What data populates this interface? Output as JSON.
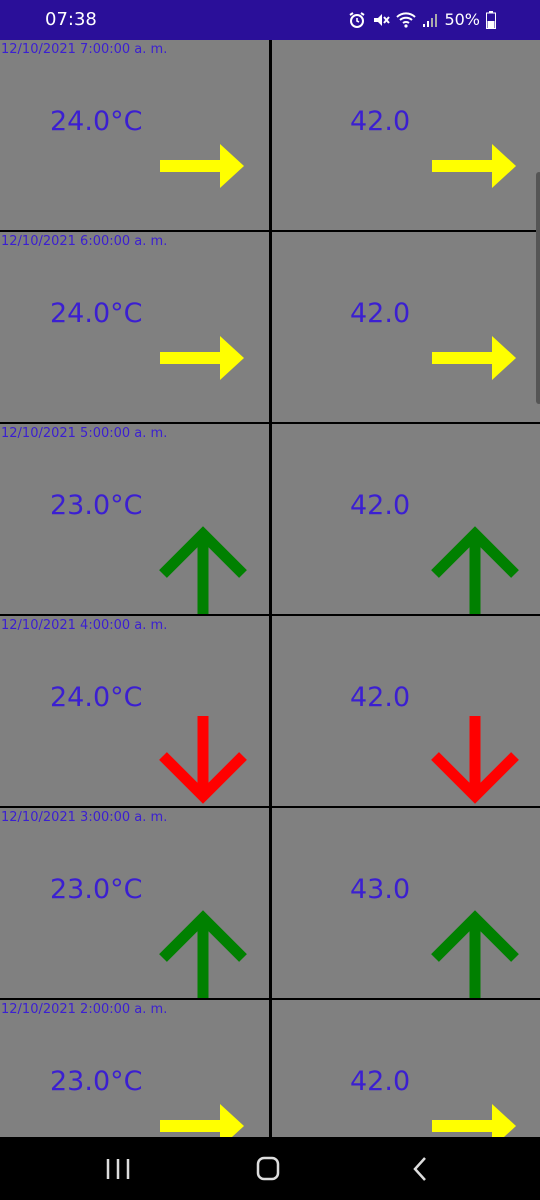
{
  "status_bar": {
    "time": "07:38",
    "battery": "50%"
  },
  "colors": {
    "up": "#008000",
    "down": "#ff0000",
    "flat": "#ffff00",
    "text": "#3b1fd1",
    "cell_bg": "#808080"
  },
  "rows": [
    {
      "timestamp": "12/10/2021 7:00:00 a. m.",
      "temperature": "24.0°C",
      "temp_trend": "flat",
      "humidity": "42.0",
      "hum_trend": "flat"
    },
    {
      "timestamp": "12/10/2021 6:00:00 a. m.",
      "temperature": "24.0°C",
      "temp_trend": "flat",
      "humidity": "42.0",
      "hum_trend": "flat"
    },
    {
      "timestamp": "12/10/2021 5:00:00 a. m.",
      "temperature": "23.0°C",
      "temp_trend": "up",
      "humidity": "42.0",
      "hum_trend": "up"
    },
    {
      "timestamp": "12/10/2021 4:00:00 a. m.",
      "temperature": "24.0°C",
      "temp_trend": "down",
      "humidity": "42.0",
      "hum_trend": "down"
    },
    {
      "timestamp": "12/10/2021 3:00:00 a. m.",
      "temperature": "23.0°C",
      "temp_trend": "up",
      "humidity": "43.0",
      "hum_trend": "up"
    },
    {
      "timestamp": "12/10/2021 2:00:00 a. m.",
      "temperature": "23.0°C",
      "temp_trend": "flat",
      "humidity": "42.0",
      "hum_trend": "flat"
    }
  ]
}
